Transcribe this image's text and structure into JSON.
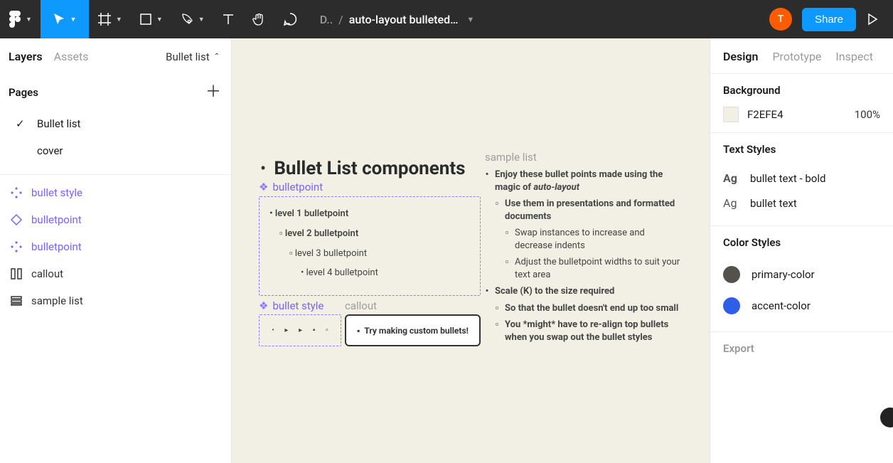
{
  "toolbar": {
    "breadcrumb1": "D..",
    "breadcrumb_sep": "/",
    "filename": "auto-layout bulleted…",
    "avatar_letter": "T",
    "share_label": "Share"
  },
  "left": {
    "tab_layers": "Layers",
    "tab_assets": "Assets",
    "page_indicator": "Bullet list",
    "pages_header": "Pages",
    "pages": [
      {
        "name": "Bullet list",
        "checked": true
      },
      {
        "name": "cover",
        "checked": false
      }
    ],
    "layers": [
      {
        "name": "bullet style",
        "kind": "component"
      },
      {
        "name": "bulletpoint",
        "kind": "outline"
      },
      {
        "name": "bulletpoint",
        "kind": "component"
      },
      {
        "name": "callout",
        "kind": "callout"
      },
      {
        "name": "sample list",
        "kind": "frame"
      }
    ]
  },
  "canvas": {
    "heading": "Bullet List components",
    "label_bulletpoint": "bulletpoint",
    "label_bulletstyle": "bullet style",
    "label_callout": "callout",
    "label_sample": "sample list",
    "levels": {
      "l1": "level 1 bulletpoint",
      "l2": "level 2 bulletpoint",
      "l3": "level 3 bulletpoint",
      "l4": "level 4 bulletpoint"
    },
    "callout_text": "Try making custom bullets!",
    "sample": {
      "s1a": "Enjoy these bullet points made using the magic of ",
      "s1b": "auto-layout",
      "s2": "Use them in presentations and formatted documents",
      "s3": "Swap instances to increase and decrease indents",
      "s4": "Adjust the bulletpoint widths to suit your text area",
      "s5": "Scale (K) to the size required",
      "s6": "So that the bullet doesn't end up too small",
      "s7": "You *might* have to re-align top bullets when you swap out the bullet styles"
    }
  },
  "right": {
    "tab_design": "Design",
    "tab_prototype": "Prototype",
    "tab_inspect": "Inspect",
    "bg_header": "Background",
    "bg_hex": "F2EFE4",
    "bg_opacity": "100%",
    "ts_header": "Text Styles",
    "ts1": "bullet text - bold",
    "ts2": "bullet text",
    "cs_header": "Color Styles",
    "cs1": "primary-color",
    "cs2": "accent-color",
    "cs1_color": "#54524a",
    "cs2_color": "#2f5fe8",
    "export_header": "Export"
  }
}
